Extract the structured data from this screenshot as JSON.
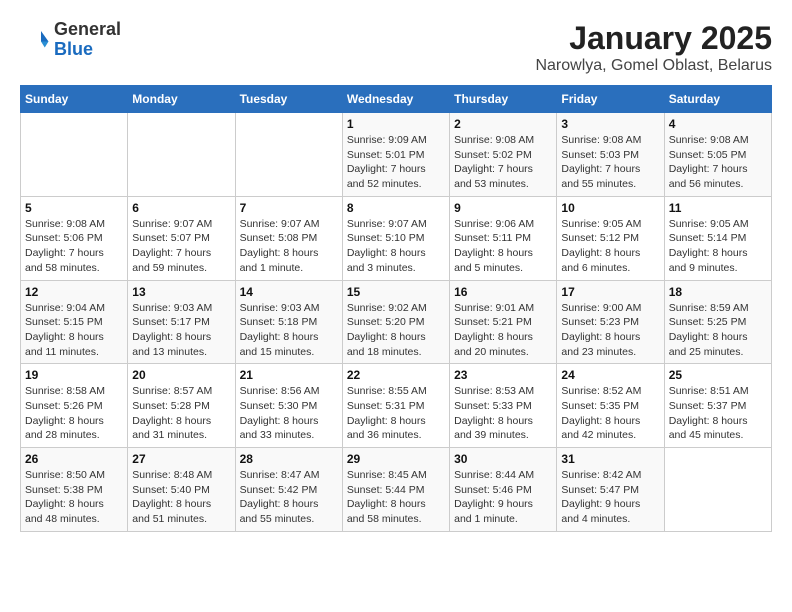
{
  "logo": {
    "general": "General",
    "blue": "Blue"
  },
  "title": "January 2025",
  "subtitle": "Narowlya, Gomel Oblast, Belarus",
  "weekdays": [
    "Sunday",
    "Monday",
    "Tuesday",
    "Wednesday",
    "Thursday",
    "Friday",
    "Saturday"
  ],
  "weeks": [
    [
      null,
      null,
      null,
      {
        "day": "1",
        "sunrise": "9:09 AM",
        "sunset": "5:01 PM",
        "daylight": "7 hours and 52 minutes."
      },
      {
        "day": "2",
        "sunrise": "9:08 AM",
        "sunset": "5:02 PM",
        "daylight": "7 hours and 53 minutes."
      },
      {
        "day": "3",
        "sunrise": "9:08 AM",
        "sunset": "5:03 PM",
        "daylight": "7 hours and 55 minutes."
      },
      {
        "day": "4",
        "sunrise": "9:08 AM",
        "sunset": "5:05 PM",
        "daylight": "7 hours and 56 minutes."
      }
    ],
    [
      {
        "day": "5",
        "sunrise": "9:08 AM",
        "sunset": "5:06 PM",
        "daylight": "7 hours and 58 minutes."
      },
      {
        "day": "6",
        "sunrise": "9:07 AM",
        "sunset": "5:07 PM",
        "daylight": "7 hours and 59 minutes."
      },
      {
        "day": "7",
        "sunrise": "9:07 AM",
        "sunset": "5:08 PM",
        "daylight": "8 hours and 1 minute."
      },
      {
        "day": "8",
        "sunrise": "9:07 AM",
        "sunset": "5:10 PM",
        "daylight": "8 hours and 3 minutes."
      },
      {
        "day": "9",
        "sunrise": "9:06 AM",
        "sunset": "5:11 PM",
        "daylight": "8 hours and 5 minutes."
      },
      {
        "day": "10",
        "sunrise": "9:05 AM",
        "sunset": "5:12 PM",
        "daylight": "8 hours and 6 minutes."
      },
      {
        "day": "11",
        "sunrise": "9:05 AM",
        "sunset": "5:14 PM",
        "daylight": "8 hours and 9 minutes."
      }
    ],
    [
      {
        "day": "12",
        "sunrise": "9:04 AM",
        "sunset": "5:15 PM",
        "daylight": "8 hours and 11 minutes."
      },
      {
        "day": "13",
        "sunrise": "9:03 AM",
        "sunset": "5:17 PM",
        "daylight": "8 hours and 13 minutes."
      },
      {
        "day": "14",
        "sunrise": "9:03 AM",
        "sunset": "5:18 PM",
        "daylight": "8 hours and 15 minutes."
      },
      {
        "day": "15",
        "sunrise": "9:02 AM",
        "sunset": "5:20 PM",
        "daylight": "8 hours and 18 minutes."
      },
      {
        "day": "16",
        "sunrise": "9:01 AM",
        "sunset": "5:21 PM",
        "daylight": "8 hours and 20 minutes."
      },
      {
        "day": "17",
        "sunrise": "9:00 AM",
        "sunset": "5:23 PM",
        "daylight": "8 hours and 23 minutes."
      },
      {
        "day": "18",
        "sunrise": "8:59 AM",
        "sunset": "5:25 PM",
        "daylight": "8 hours and 25 minutes."
      }
    ],
    [
      {
        "day": "19",
        "sunrise": "8:58 AM",
        "sunset": "5:26 PM",
        "daylight": "8 hours and 28 minutes."
      },
      {
        "day": "20",
        "sunrise": "8:57 AM",
        "sunset": "5:28 PM",
        "daylight": "8 hours and 31 minutes."
      },
      {
        "day": "21",
        "sunrise": "8:56 AM",
        "sunset": "5:30 PM",
        "daylight": "8 hours and 33 minutes."
      },
      {
        "day": "22",
        "sunrise": "8:55 AM",
        "sunset": "5:31 PM",
        "daylight": "8 hours and 36 minutes."
      },
      {
        "day": "23",
        "sunrise": "8:53 AM",
        "sunset": "5:33 PM",
        "daylight": "8 hours and 39 minutes."
      },
      {
        "day": "24",
        "sunrise": "8:52 AM",
        "sunset": "5:35 PM",
        "daylight": "8 hours and 42 minutes."
      },
      {
        "day": "25",
        "sunrise": "8:51 AM",
        "sunset": "5:37 PM",
        "daylight": "8 hours and 45 minutes."
      }
    ],
    [
      {
        "day": "26",
        "sunrise": "8:50 AM",
        "sunset": "5:38 PM",
        "daylight": "8 hours and 48 minutes."
      },
      {
        "day": "27",
        "sunrise": "8:48 AM",
        "sunset": "5:40 PM",
        "daylight": "8 hours and 51 minutes."
      },
      {
        "day": "28",
        "sunrise": "8:47 AM",
        "sunset": "5:42 PM",
        "daylight": "8 hours and 55 minutes."
      },
      {
        "day": "29",
        "sunrise": "8:45 AM",
        "sunset": "5:44 PM",
        "daylight": "8 hours and 58 minutes."
      },
      {
        "day": "30",
        "sunrise": "8:44 AM",
        "sunset": "5:46 PM",
        "daylight": "9 hours and 1 minute."
      },
      {
        "day": "31",
        "sunrise": "8:42 AM",
        "sunset": "5:47 PM",
        "daylight": "9 hours and 4 minutes."
      },
      null
    ]
  ]
}
